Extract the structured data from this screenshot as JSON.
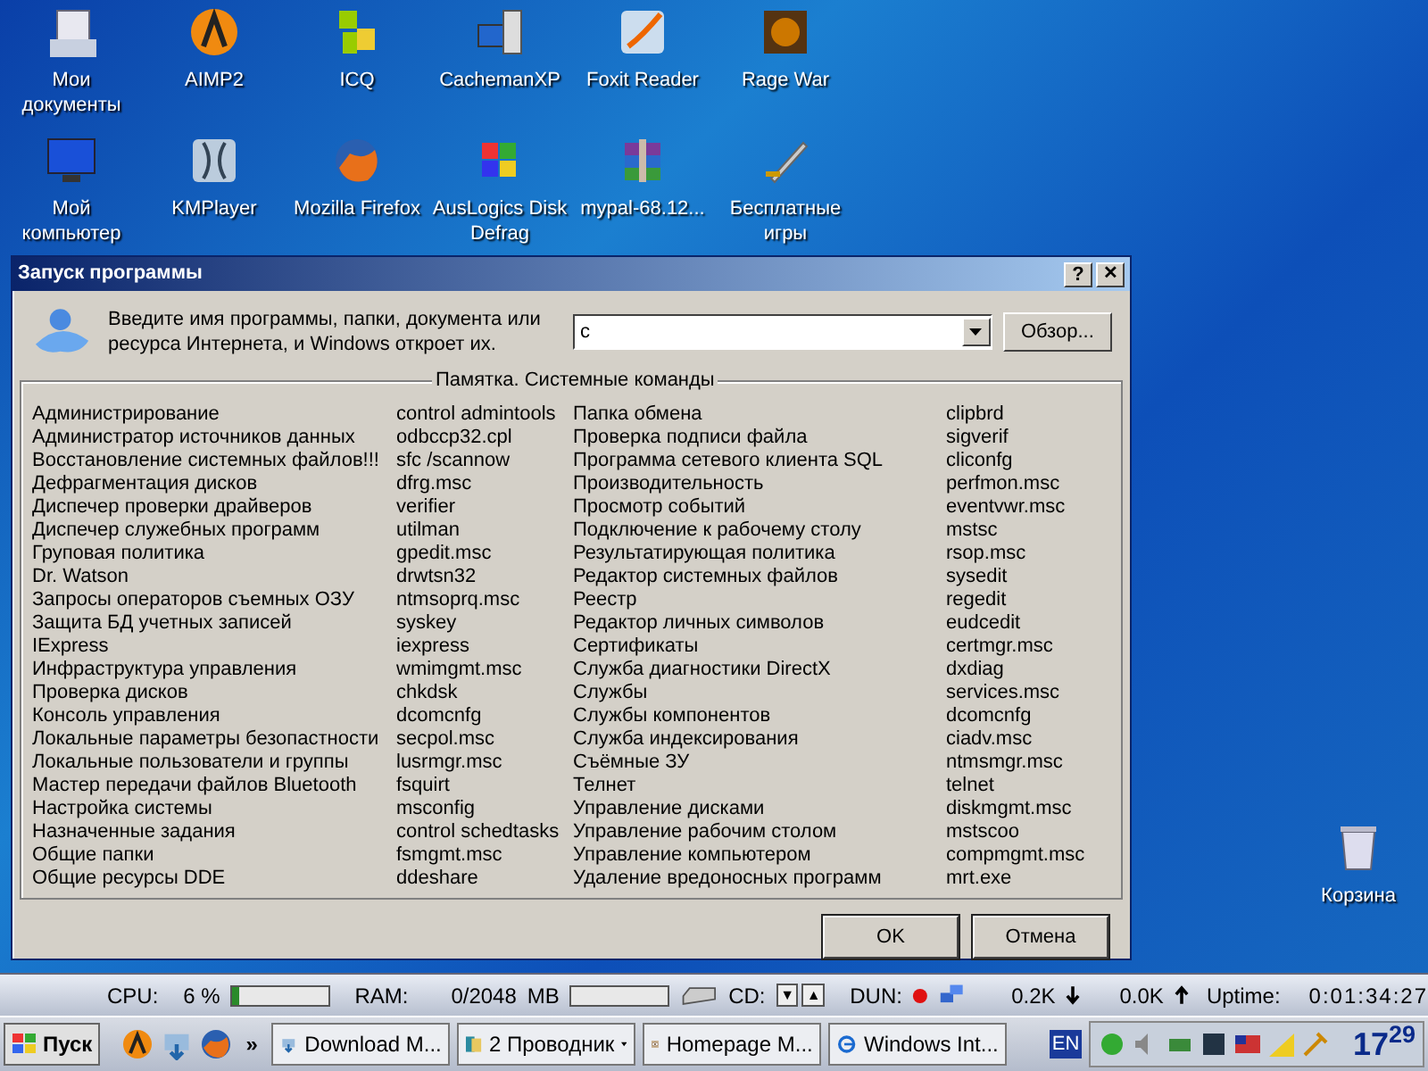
{
  "desktop_icons": [
    {
      "label": "Мои документы",
      "kind": "docs"
    },
    {
      "label": "AIMP2",
      "kind": "aimp"
    },
    {
      "label": "ICQ",
      "kind": "icq"
    },
    {
      "label": "CachemanXP",
      "kind": "pc"
    },
    {
      "label": "Foxit Reader",
      "kind": "pdf"
    },
    {
      "label": "Rage War",
      "kind": "game"
    },
    {
      "label": "Мой компьютер",
      "kind": "monitor"
    },
    {
      "label": "KMPlayer",
      "kind": "player"
    },
    {
      "label": "Mozilla Firefox",
      "kind": "firefox"
    },
    {
      "label": "AusLogics Disk Defrag",
      "kind": "defrag"
    },
    {
      "label": "mypal-68.12...",
      "kind": "archive"
    },
    {
      "label": "Бесплатные игры",
      "kind": "sword"
    }
  ],
  "recycle_bin": {
    "label": "Корзина"
  },
  "dialog": {
    "title": "Запуск программы",
    "help_button": "?",
    "close_button": "✕",
    "prompt": "Введите имя программы, папки, документа или ресурса Интернета, и Windows откроет их.",
    "open_field": {
      "value": "c"
    },
    "browse_button": "Обзор...",
    "group_title": "Памятка. Системные команды",
    "left_commands": [
      {
        "name": "Администрирование",
        "command": "control admintools"
      },
      {
        "name": "Администратор источников данных",
        "command": "odbccp32.cpl"
      },
      {
        "name": "Восстановление системных файлов!!!",
        "command": "sfc /scannow"
      },
      {
        "name": "Дефрагментация дисков",
        "command": "dfrg.msc"
      },
      {
        "name": "Диспечер проверки драйверов",
        "command": "verifier"
      },
      {
        "name": "Диспечер служебных программ",
        "command": "utilman"
      },
      {
        "name": "Груповая политика",
        "command": "gpedit.msc"
      },
      {
        "name": "Dr. Watson",
        "command": "drwtsn32"
      },
      {
        "name": "Запросы операторов съемных ОЗУ",
        "command": "ntmsoprq.msc"
      },
      {
        "name": "Защита БД учетных записей",
        "command": "syskey"
      },
      {
        "name": "IExpress",
        "command": "iexpress"
      },
      {
        "name": "Инфраструктура управления",
        "command": "wmimgmt.msc"
      },
      {
        "name": "Проверка дисков",
        "command": "chkdsk"
      },
      {
        "name": "Консоль управления",
        "command": "dcomcnfg"
      },
      {
        "name": "Локальные параметры безопастности",
        "command": "secpol.msc"
      },
      {
        "name": "Локальные пользователи и группы",
        "command": "lusrmgr.msc"
      },
      {
        "name": "Мастер передачи файлов Bluetooth",
        "command": "fsquirt"
      },
      {
        "name": "Настройка системы",
        "command": "msconfig"
      },
      {
        "name": "Назначенные задания",
        "command": "control schedtasks"
      },
      {
        "name": "Общие папки",
        "command": "fsmgmt.msc"
      },
      {
        "name": "Общие ресурсы DDE",
        "command": "ddeshare"
      }
    ],
    "right_commands": [
      {
        "name": "Папка обмена",
        "command": "clipbrd"
      },
      {
        "name": "Проверка подписи файла",
        "command": "sigverif"
      },
      {
        "name": "Программа сетевого клиента SQL",
        "command": "cliconfg"
      },
      {
        "name": "Производительность",
        "command": "perfmon.msc"
      },
      {
        "name": "Просмотр событий",
        "command": "eventvwr.msc"
      },
      {
        "name": "Подключение к рабочему столу",
        "command": "mstsc"
      },
      {
        "name": "Результатирующая политика",
        "command": "rsop.msc"
      },
      {
        "name": "Редактор системных файлов",
        "command": "sysedit"
      },
      {
        "name": "Реестр",
        "command": "regedit"
      },
      {
        "name": "Редактор личных символов",
        "command": "eudcedit"
      },
      {
        "name": "Сертификаты",
        "command": "certmgr.msc"
      },
      {
        "name": "Служба диагностики DirectX",
        "command": "dxdiag"
      },
      {
        "name": "Службы",
        "command": "services.msc"
      },
      {
        "name": "Службы компонентов",
        "command": "dcomcnfg"
      },
      {
        "name": "Служба индексирования",
        "command": "ciadv.msc"
      },
      {
        "name": "Съёмные ЗУ",
        "command": "ntmsmgr.msc"
      },
      {
        "name": "Телнет",
        "command": "telnet"
      },
      {
        "name": "Управление дисками",
        "command": "diskmgmt.msc"
      },
      {
        "name": "Управление рабочим столом",
        "command": "mstscoo"
      },
      {
        "name": "Управление компьютером",
        "command": "compmgmt.msc"
      },
      {
        "name": "Удаление вредоносных программ",
        "command": "mrt.exe"
      }
    ],
    "buttons": [
      {
        "label": "OK"
      },
      {
        "label": "Отмена"
      }
    ]
  },
  "status_bar": {
    "cpu_label": "CPU:",
    "cpu_value": "6 %",
    "cpu_meter": {
      "level": 0.06
    },
    "ram_label": "RAM:",
    "ram_value": "0/2048",
    "ram_unit": "MB",
    "ram_meter": {
      "level": 0
    },
    "cd_label": "CD:",
    "cd_eject": "▼",
    "cd_close": "▲",
    "dun_label": "DUN:",
    "download": "0.2K",
    "upload": "0.0K",
    "uptime_label": "Uptime:",
    "uptime": "0:01:34:27"
  },
  "taskbar": {
    "start": "Пуск",
    "more": "»",
    "tasks": [
      {
        "label": "Download M...",
        "kind": "download",
        "selected": false
      },
      {
        "label": "2 Проводник",
        "kind": "folder",
        "selected": false,
        "menu": true
      },
      {
        "label": "Homepage M...",
        "kind": "eye",
        "selected": false
      },
      {
        "label": "Windows Int...",
        "kind": "ie",
        "selected": false
      }
    ],
    "language": "EN",
    "clock": "17$^{29}$"
  }
}
